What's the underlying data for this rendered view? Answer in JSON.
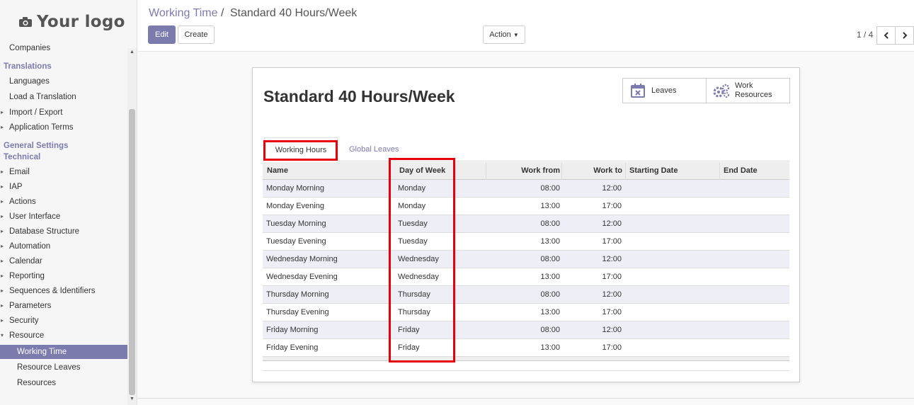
{
  "logo": {
    "text": "Your logo",
    "icon": "camera-icon"
  },
  "sidebar": {
    "items": [
      {
        "label": "Companies",
        "kind": "sub"
      },
      {
        "label": "Translations",
        "kind": "section"
      },
      {
        "label": "Languages",
        "kind": "sub"
      },
      {
        "label": "Load a Translation",
        "kind": "sub"
      },
      {
        "label": "Import / Export",
        "kind": "caret"
      },
      {
        "label": "Application Terms",
        "kind": "caret"
      },
      {
        "label": "General Settings",
        "kind": "section"
      },
      {
        "label": "Technical",
        "kind": "section"
      },
      {
        "label": "Email",
        "kind": "caret"
      },
      {
        "label": "IAP",
        "kind": "caret"
      },
      {
        "label": "Actions",
        "kind": "caret"
      },
      {
        "label": "User Interface",
        "kind": "caret"
      },
      {
        "label": "Database Structure",
        "kind": "caret"
      },
      {
        "label": "Automation",
        "kind": "caret"
      },
      {
        "label": "Calendar",
        "kind": "caret"
      },
      {
        "label": "Reporting",
        "kind": "caret"
      },
      {
        "label": "Sequences & Identifiers",
        "kind": "caret"
      },
      {
        "label": "Parameters",
        "kind": "caret"
      },
      {
        "label": "Security",
        "kind": "caret"
      },
      {
        "label": "Resource",
        "kind": "open"
      },
      {
        "label": "Working Time",
        "kind": "leaf2-active"
      },
      {
        "label": "Resource Leaves",
        "kind": "leaf2"
      },
      {
        "label": "Resources",
        "kind": "leaf2"
      }
    ]
  },
  "breadcrumb": {
    "parent": "Working Time",
    "separator": "/",
    "current": "Standard 40 Hours/Week"
  },
  "toolbar": {
    "edit_label": "Edit",
    "create_label": "Create",
    "action_label": "Action"
  },
  "pager": {
    "value": "1 / 4"
  },
  "record": {
    "title": "Standard 40 Hours/Week",
    "buttons": {
      "leaves_label": "Leaves",
      "work_resources_label_1": "Work",
      "work_resources_label_2": "Resources"
    }
  },
  "tabs": {
    "working_hours": "Working Hours",
    "global_leaves": "Global Leaves"
  },
  "table": {
    "headers": {
      "name": "Name",
      "day": "Day of Week",
      "from": "Work from",
      "to": "Work to",
      "start": "Starting Date",
      "end": "End Date"
    },
    "rows": [
      {
        "name": "Monday Morning",
        "day": "Monday",
        "from": "08:00",
        "to": "12:00"
      },
      {
        "name": "Monday Evening",
        "day": "Monday",
        "from": "13:00",
        "to": "17:00"
      },
      {
        "name": "Tuesday Morning",
        "day": "Tuesday",
        "from": "08:00",
        "to": "12:00"
      },
      {
        "name": "Tuesday Evening",
        "day": "Tuesday",
        "from": "13:00",
        "to": "17:00"
      },
      {
        "name": "Wednesday Morning",
        "day": "Wednesday",
        "from": "08:00",
        "to": "12:00"
      },
      {
        "name": "Wednesday Evening",
        "day": "Wednesday",
        "from": "13:00",
        "to": "17:00"
      },
      {
        "name": "Thursday Morning",
        "day": "Thursday",
        "from": "08:00",
        "to": "12:00"
      },
      {
        "name": "Thursday Evening",
        "day": "Thursday",
        "from": "13:00",
        "to": "17:00"
      },
      {
        "name": "Friday Morning",
        "day": "Friday",
        "from": "08:00",
        "to": "12:00"
      },
      {
        "name": "Friday Evening",
        "day": "Friday",
        "from": "13:00",
        "to": "17:00"
      }
    ]
  },
  "colors": {
    "accent": "#7c7bad",
    "highlight": "#e8000b",
    "row_alt": "#eeeef6"
  }
}
